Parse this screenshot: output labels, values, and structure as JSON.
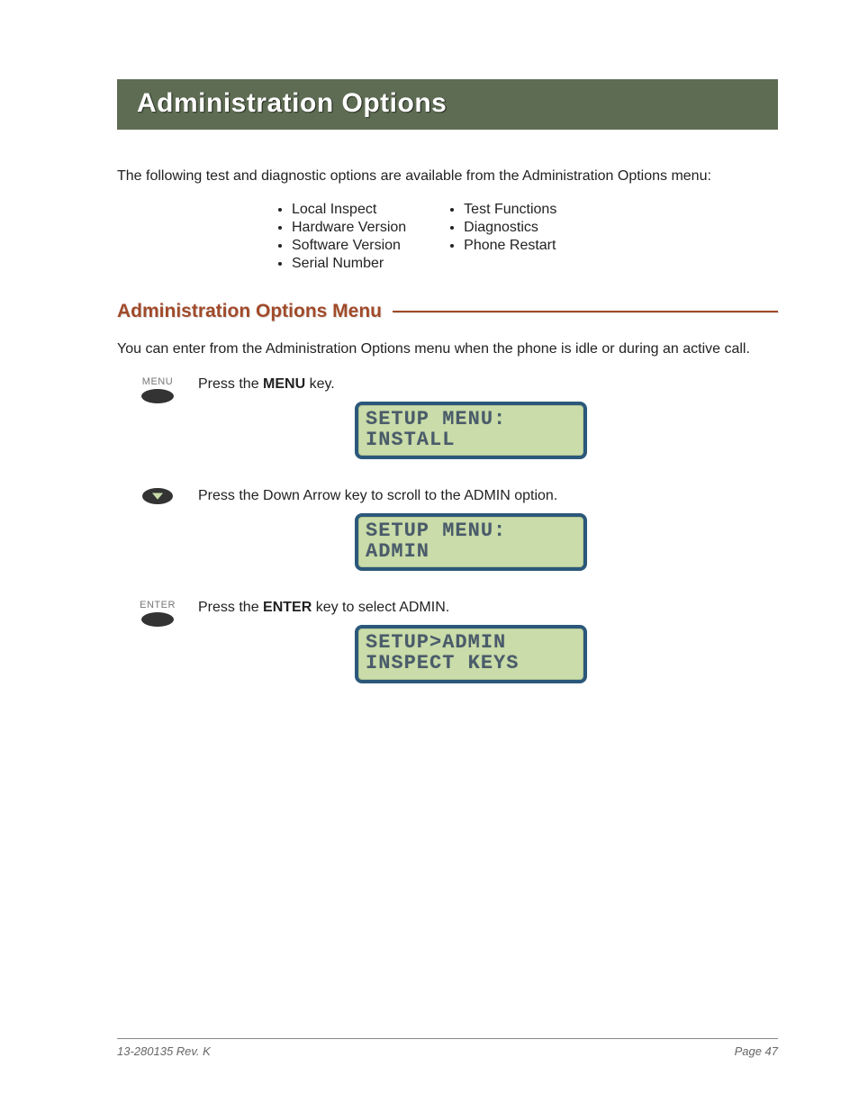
{
  "title": "Administration Options",
  "intro": "The following test and diagnostic options are available from the Administration Options menu:",
  "options_col1": [
    "Local Inspect",
    "Hardware Version",
    "Software Version",
    "Serial Number"
  ],
  "options_col2": [
    "Test Functions",
    "Diagnostics",
    "Phone Restart"
  ],
  "section_heading": "Administration Options Menu",
  "section_text": "You can enter from the Administration Options menu when the phone is idle or during an active call.",
  "steps": [
    {
      "key_label": "MENU",
      "key_kind": "oval",
      "pre": "Press the ",
      "bold": "MENU",
      "post": " key.",
      "lcd": [
        "SETUP MENU:",
        "INSTALL"
      ]
    },
    {
      "key_label": "",
      "key_kind": "arrow",
      "pre": "Press the Down Arrow key to scroll to the ADMIN option.",
      "bold": "",
      "post": "",
      "lcd": [
        "SETUP MENU:",
        "ADMIN"
      ]
    },
    {
      "key_label": "ENTER",
      "key_kind": "oval",
      "pre": "Press the ",
      "bold": "ENTER",
      "post": " key to select ADMIN.",
      "lcd": [
        "SETUP>ADMIN",
        "INSPECT KEYS"
      ]
    }
  ],
  "footer": {
    "left": "13-280135  Rev. K",
    "right": "Page 47"
  }
}
